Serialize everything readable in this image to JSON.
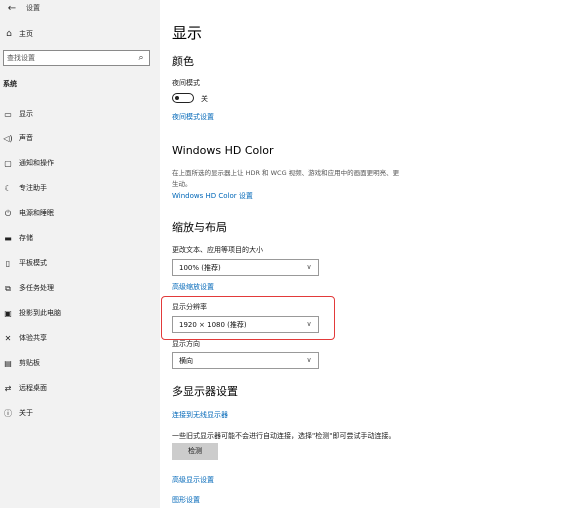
{
  "window": {
    "title": "设置"
  },
  "sidebar": {
    "home_label": "主页",
    "search": {
      "placeholder": "查找设置"
    },
    "section_label": "系统",
    "items": [
      {
        "label": "显示",
        "icon": "monitor-icon"
      },
      {
        "label": "声音",
        "icon": "speaker-icon"
      },
      {
        "label": "通知和操作",
        "icon": "notification-icon"
      },
      {
        "label": "专注助手",
        "icon": "moon-icon"
      },
      {
        "label": "电源和睡眠",
        "icon": "power-icon"
      },
      {
        "label": "存储",
        "icon": "storage-icon"
      },
      {
        "label": "平板模式",
        "icon": "tablet-icon"
      },
      {
        "label": "多任务处理",
        "icon": "multitask-icon"
      },
      {
        "label": "投影到此电脑",
        "icon": "projector-icon"
      },
      {
        "label": "体验共享",
        "icon": "share-icon"
      },
      {
        "label": "剪贴板",
        "icon": "clipboard-icon"
      },
      {
        "label": "远程桌面",
        "icon": "remote-desktop-icon"
      },
      {
        "label": "关于",
        "icon": "info-icon"
      }
    ]
  },
  "main": {
    "title": "显示",
    "color_section": {
      "heading": "颜色",
      "night_light_label": "夜间模式",
      "night_light_state": "关",
      "night_light_on": false,
      "night_light_settings_link": "夜间模式设置"
    },
    "hdr_section": {
      "heading": "Windows HD Color",
      "description": "在上面所选的显示器上让 HDR 和 WCG 视频、游戏和应用中的画面更明亮、更生动。",
      "settings_link": "Windows HD Color 设置"
    },
    "scale_section": {
      "heading": "缩放与布局",
      "scale_label": "更改文本、应用等项目的大小",
      "scale_value": "100% (推荐)",
      "advanced_scale_link": "高级缩放设置",
      "resolution_label": "显示分辨率",
      "resolution_value": "1920 × 1080 (推荐)",
      "orientation_label": "显示方向",
      "orientation_value": "横向"
    },
    "multi_display_section": {
      "heading": "多显示器设置",
      "wireless_link": "连接到无线显示器",
      "hint": "一些旧式显示器可能不会进行自动连接，选择\"检测\"即可尝试手动连接。",
      "detect_button": "检测",
      "advanced_display_link": "高级显示设置",
      "graphics_link": "图形设置"
    }
  },
  "colors": {
    "accent_link": "#0067b8",
    "highlight": "#e23a3a",
    "sidebar_bg": "#f2f2f2"
  }
}
